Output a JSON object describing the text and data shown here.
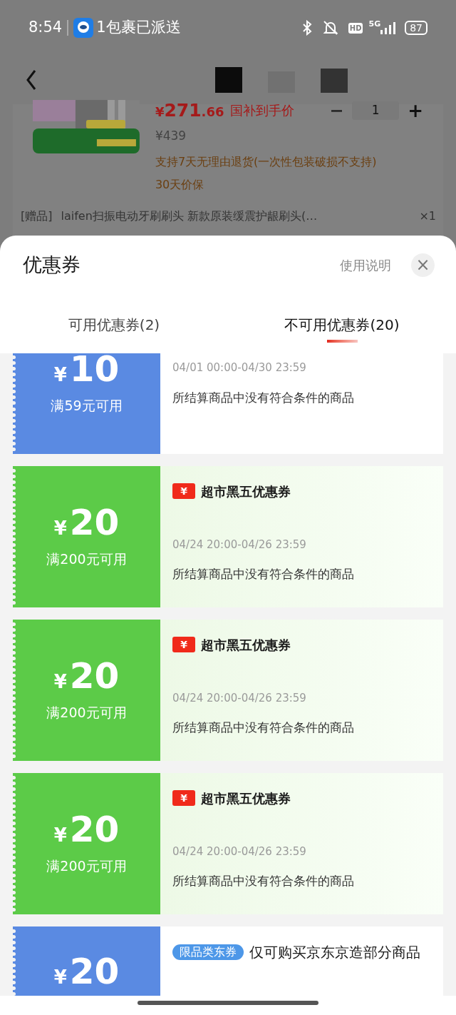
{
  "status_bar": {
    "time": "8:54",
    "notification": "1包裹已派送",
    "hd": "HD",
    "network": "5G",
    "battery": "87"
  },
  "product": {
    "price_symbol": "¥",
    "price_int": "271",
    "price_dec": ".66",
    "price_label": "国补到手价",
    "original_price": "¥439",
    "quantity": "1",
    "minus": "−",
    "plus": "+",
    "return_policy": "支持7天无理由退货(一次性包装破损不支持)",
    "price_protect": "30天价保",
    "gift_tag": "[赠品]",
    "gift_name": "laifen扫振电动牙刷刷头 新款原装缓震护龈刷头(…",
    "gift_qty": "×1"
  },
  "sheet": {
    "title": "优惠券",
    "help": "使用说明",
    "close": "×"
  },
  "tabs": [
    {
      "label": "可用优惠券(2)",
      "selected": false
    },
    {
      "label": "不可用优惠券(20)",
      "selected": true
    }
  ],
  "coupons": [
    {
      "kind": "plain",
      "color": "#5a8ae2",
      "symbol": "¥",
      "amount": "10",
      "condition": "满59元可用",
      "date": "04/01 00:00-04/30 23:59",
      "desc": "所结算商品中没有符合条件的商品"
    },
    {
      "kind": "badge",
      "color": "#5ccb48",
      "symbol": "¥",
      "amount": "20",
      "condition": "满200元可用",
      "badge": "¥",
      "title": "超市黑五优惠券",
      "date": "04/24 20:00-04/26 23:59",
      "desc": "所结算商品中没有符合条件的商品"
    },
    {
      "kind": "badge",
      "color": "#5ccb48",
      "symbol": "¥",
      "amount": "20",
      "condition": "满200元可用",
      "badge": "¥",
      "title": "超市黑五优惠券",
      "date": "04/24 20:00-04/26 23:59",
      "desc": "所结算商品中没有符合条件的商品"
    },
    {
      "kind": "badge",
      "color": "#5ccb48",
      "symbol": "¥",
      "amount": "20",
      "condition": "满200元可用",
      "badge": "¥",
      "title": "超市黑五优惠券",
      "date": "04/24 20:00-04/26 23:59",
      "desc": "所结算商品中没有符合条件的商品"
    },
    {
      "kind": "pill",
      "color": "#5a8ae2",
      "symbol": "¥",
      "amount": "20",
      "badge": "限品类东券",
      "title": "仅可购买京东京造部分商品"
    }
  ]
}
